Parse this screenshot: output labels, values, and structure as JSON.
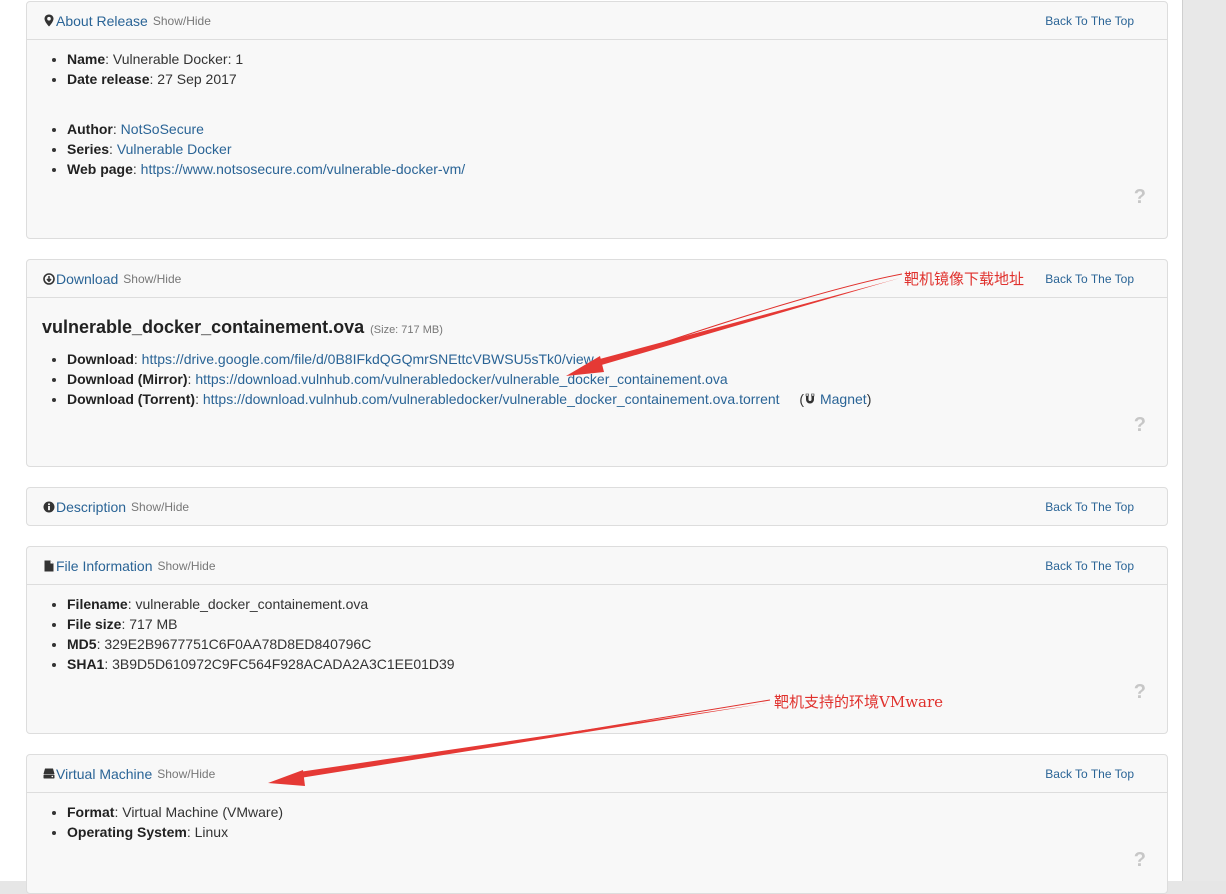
{
  "common": {
    "show_hide": "Show/Hide",
    "back_top": "Back To The Top",
    "help": "?"
  },
  "about": {
    "title": "About Release",
    "group1": [
      {
        "label": "Name",
        "value": "Vulnerable Docker: 1"
      },
      {
        "label": "Date release",
        "value": "27 Sep 2017"
      }
    ],
    "group2": [
      {
        "label": "Author",
        "value": "NotSoSecure"
      },
      {
        "label": "Series",
        "value": "Vulnerable Docker"
      },
      {
        "label": "Web page",
        "value": "https://www.notsosecure.com/vulnerable-docker-vm/"
      }
    ]
  },
  "download": {
    "title": "Download",
    "file_title": "vulnerable_docker_containement.ova",
    "size": "(Size: 717 MB)",
    "items": [
      {
        "label": "Download",
        "value": "https://drive.google.com/file/d/0B8IFkdQGQmrSNEttcVBWSU5sTk0/view"
      },
      {
        "label": "Download (Mirror)",
        "value": "https://download.vulnhub.com/vulnerabledocker/vulnerable_docker_containement.ova"
      },
      {
        "label": "Download (Torrent)",
        "value": "https://download.vulnhub.com/vulnerabledocker/vulnerable_docker_containement.ova.torrent"
      }
    ],
    "magnet_open": "(",
    "magnet_label": "Magnet",
    "magnet_close": ")"
  },
  "description": {
    "title": "Description"
  },
  "file_info": {
    "title": "File Information",
    "items": [
      {
        "label": "Filename",
        "value": "vulnerable_docker_containement.ova"
      },
      {
        "label": "File size",
        "value": "717 MB"
      },
      {
        "label": "MD5",
        "value": "329E2B9677751C6F0AA78D8ED840796C"
      },
      {
        "label": "SHA1",
        "value": "3B9D5D610972C9FC564F928ACADA2A3C1EE01D39"
      }
    ]
  },
  "vm": {
    "title": "Virtual Machine",
    "items": [
      {
        "label": "Format",
        "value": "Virtual Machine (VMware)"
      },
      {
        "label": "Operating System",
        "value": "Linux"
      }
    ]
  },
  "annotations": {
    "download_note": "靶机镜像下载地址",
    "vm_note": "靶机支持的环境VMware",
    "color": "#e0312d"
  }
}
